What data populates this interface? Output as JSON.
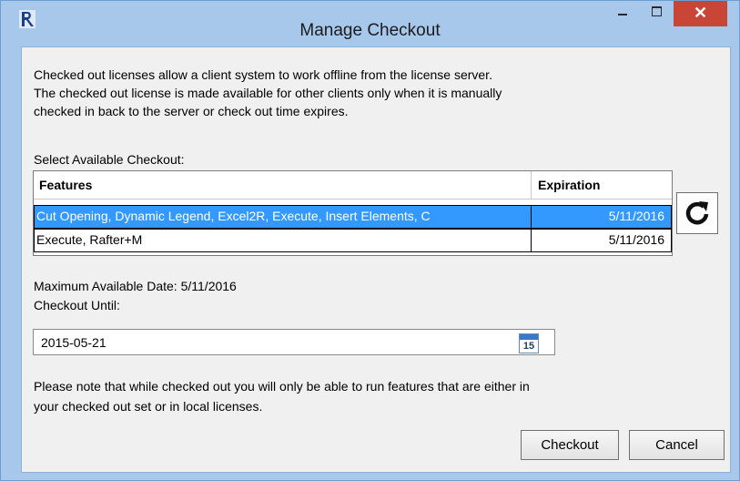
{
  "window": {
    "title": "Manage Checkout",
    "close_glyph": "✕",
    "icon": "app-logo-icon"
  },
  "description": {
    "line1": "Checked out licenses allow a client system to work offline from the license server.",
    "line2": "The checked out license is made available for other clients only when it is manually",
    "line3": "checked in back to the server or check out time expires."
  },
  "select_label": "Select Available Checkout:",
  "grid": {
    "columns": {
      "features": "Features",
      "expiration": "Expiration"
    },
    "rows": [
      {
        "features": "Cut Opening, Dynamic Legend, Excel2R, Execute, Insert Elements, C",
        "expiration": "5/11/2016",
        "selected": true
      },
      {
        "features": "Execute, Rafter+M",
        "expiration": "5/11/2016",
        "selected": false
      }
    ]
  },
  "refresh_icon": "refresh-icon",
  "max_date": {
    "label": "Maximum Available Date:",
    "value": "5/11/2016"
  },
  "checkout_until": {
    "label": "Checkout Until:",
    "value": "2015-05-21",
    "calendar_day": "15"
  },
  "note": {
    "line1": "Please note that while checked out you will only be able to run features that are either in",
    "line2": "your checked out set or in local licenses."
  },
  "buttons": {
    "checkout": "Checkout",
    "cancel": "Cancel"
  },
  "colors": {
    "selection": "#3399ff",
    "close": "#c94536",
    "frame": "#a7c8ea"
  }
}
